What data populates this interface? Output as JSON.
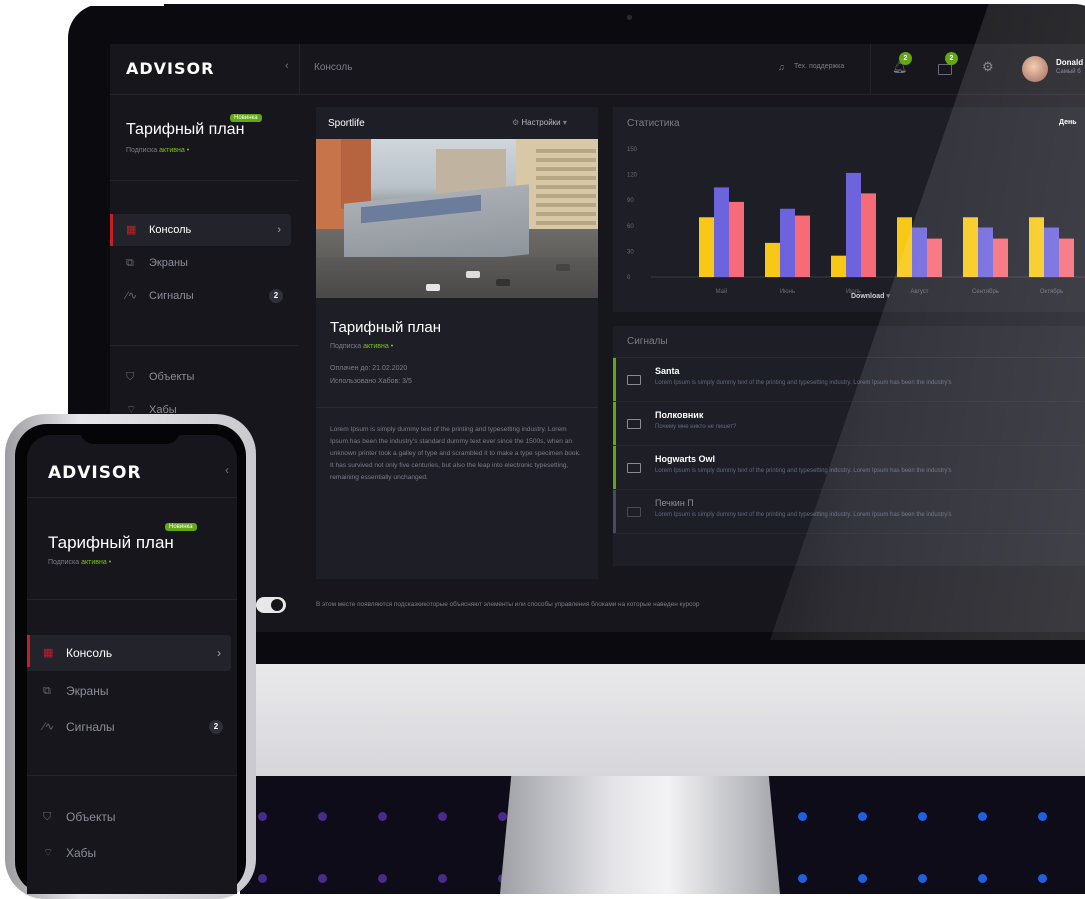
{
  "brand": {
    "logo": "ADVISOR"
  },
  "topbar": {
    "breadcrumb": "Консоль",
    "support_label": "Тех. поддержка",
    "notifications_count": "2",
    "messages_count": "2",
    "user_name": "Donald",
    "user_role": "Самый б"
  },
  "sidebar": {
    "plan_title": "Тарифный план",
    "new_badge": "Новинка",
    "subscription_prefix": "Подписка",
    "subscription_status": "активна",
    "status_dot": "•",
    "items": [
      {
        "label": "Консоль",
        "icon": "grid-icon",
        "active": true
      },
      {
        "label": "Экраны",
        "icon": "screens-icon"
      },
      {
        "label": "Сигналы",
        "icon": "signal-icon",
        "count": "2"
      },
      {
        "label": "Объекты",
        "icon": "shield-icon"
      },
      {
        "label": "Хабы",
        "icon": "wifi-icon"
      }
    ]
  },
  "object_card": {
    "title": "Sportlife",
    "settings_label": "Настройки",
    "plan_title": "Тарифный план",
    "subscription_prefix": "Подписка",
    "subscription_status": "активна",
    "paid_until": "Оплачен до: 21.02.2020",
    "hubs_used": "Использовано Хабов: 3/5",
    "description": "Lorem Ipsum is simply dummy text of the printing and typesetting industry. Lorem Ipsum has been the industry's standard dummy text ever since the 1500s, when an unknown printer took a galley of type and scrambled it to make a type specimen book. It has survived not only five centuries, but also the leap into electronic typesetting, remaining essentially unchanged."
  },
  "stats_card": {
    "title": "Статистика",
    "period": "День",
    "download_label": "Download"
  },
  "chart_data": {
    "type": "bar",
    "categories": [
      "Май",
      "Июнь",
      "Июль",
      "Август",
      "Сентябрь",
      "Октябрь"
    ],
    "yticks": [
      "150",
      "120",
      "90",
      "60",
      "30",
      "0"
    ],
    "ylim": [
      0,
      150
    ],
    "series": [
      {
        "color": "#f7c815",
        "values": [
          70,
          40,
          25,
          70,
          70,
          70
        ]
      },
      {
        "color": "#6d63dc",
        "values": [
          105,
          80,
          122,
          58,
          58,
          58
        ]
      },
      {
        "color": "#f76a77",
        "values": [
          88,
          72,
          98,
          45,
          45,
          45
        ]
      }
    ]
  },
  "signals_card": {
    "title": "Сигналы",
    "items": [
      {
        "title": "Santa",
        "text": "Lorem Ipsum is simply dummy text of the printing and typesetting industry. Lorem Ipsum has been the industry's",
        "color": "#63a616"
      },
      {
        "title": "Полковник",
        "text": "Почему мне никто не пишет?",
        "color": "#63a616"
      },
      {
        "title": "Hogwarts Owl",
        "text": "Lorem Ipsum is simply dummy text of the printing and typesetting industry. Lorem Ipsum has been the industry's",
        "color": "#63a616"
      },
      {
        "title": "Печкин П",
        "text": "Lorem Ipsum is simply dummy text of the printing and typesetting industry. Lorem Ipsum has been the industry's",
        "color": "#4a4a66"
      }
    ]
  },
  "footer_hint": "В этом месте появляются подсказкикоторые объясняют элементы или способы управления блоками на которые наведен курсор"
}
